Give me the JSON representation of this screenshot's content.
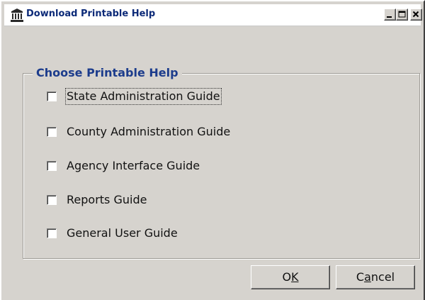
{
  "window": {
    "title": "Download Printable Help"
  },
  "group": {
    "legend": "Choose Printable Help",
    "options": [
      {
        "label": "State Administration Guide",
        "checked": false,
        "focused": true
      },
      {
        "label": "County Administration Guide",
        "checked": false,
        "focused": false
      },
      {
        "label": "Agency Interface Guide",
        "checked": false,
        "focused": false
      },
      {
        "label": "Reports Guide",
        "checked": false,
        "focused": false
      },
      {
        "label": "General User Guide",
        "checked": false,
        "focused": false
      }
    ]
  },
  "buttons": {
    "ok": {
      "pre": "O",
      "mnemonic": "K",
      "post": ""
    },
    "cancel": {
      "pre": "C",
      "mnemonic": "a",
      "post": "ncel"
    }
  },
  "icons": {
    "app": "government-building-icon",
    "minimize": "minimize-icon",
    "maximize": "maximize-icon",
    "close": "close-icon"
  },
  "colors": {
    "title_text": "#0c2a78",
    "legend_text": "#1c3c8c",
    "dialog_face": "#d6d3ce"
  }
}
